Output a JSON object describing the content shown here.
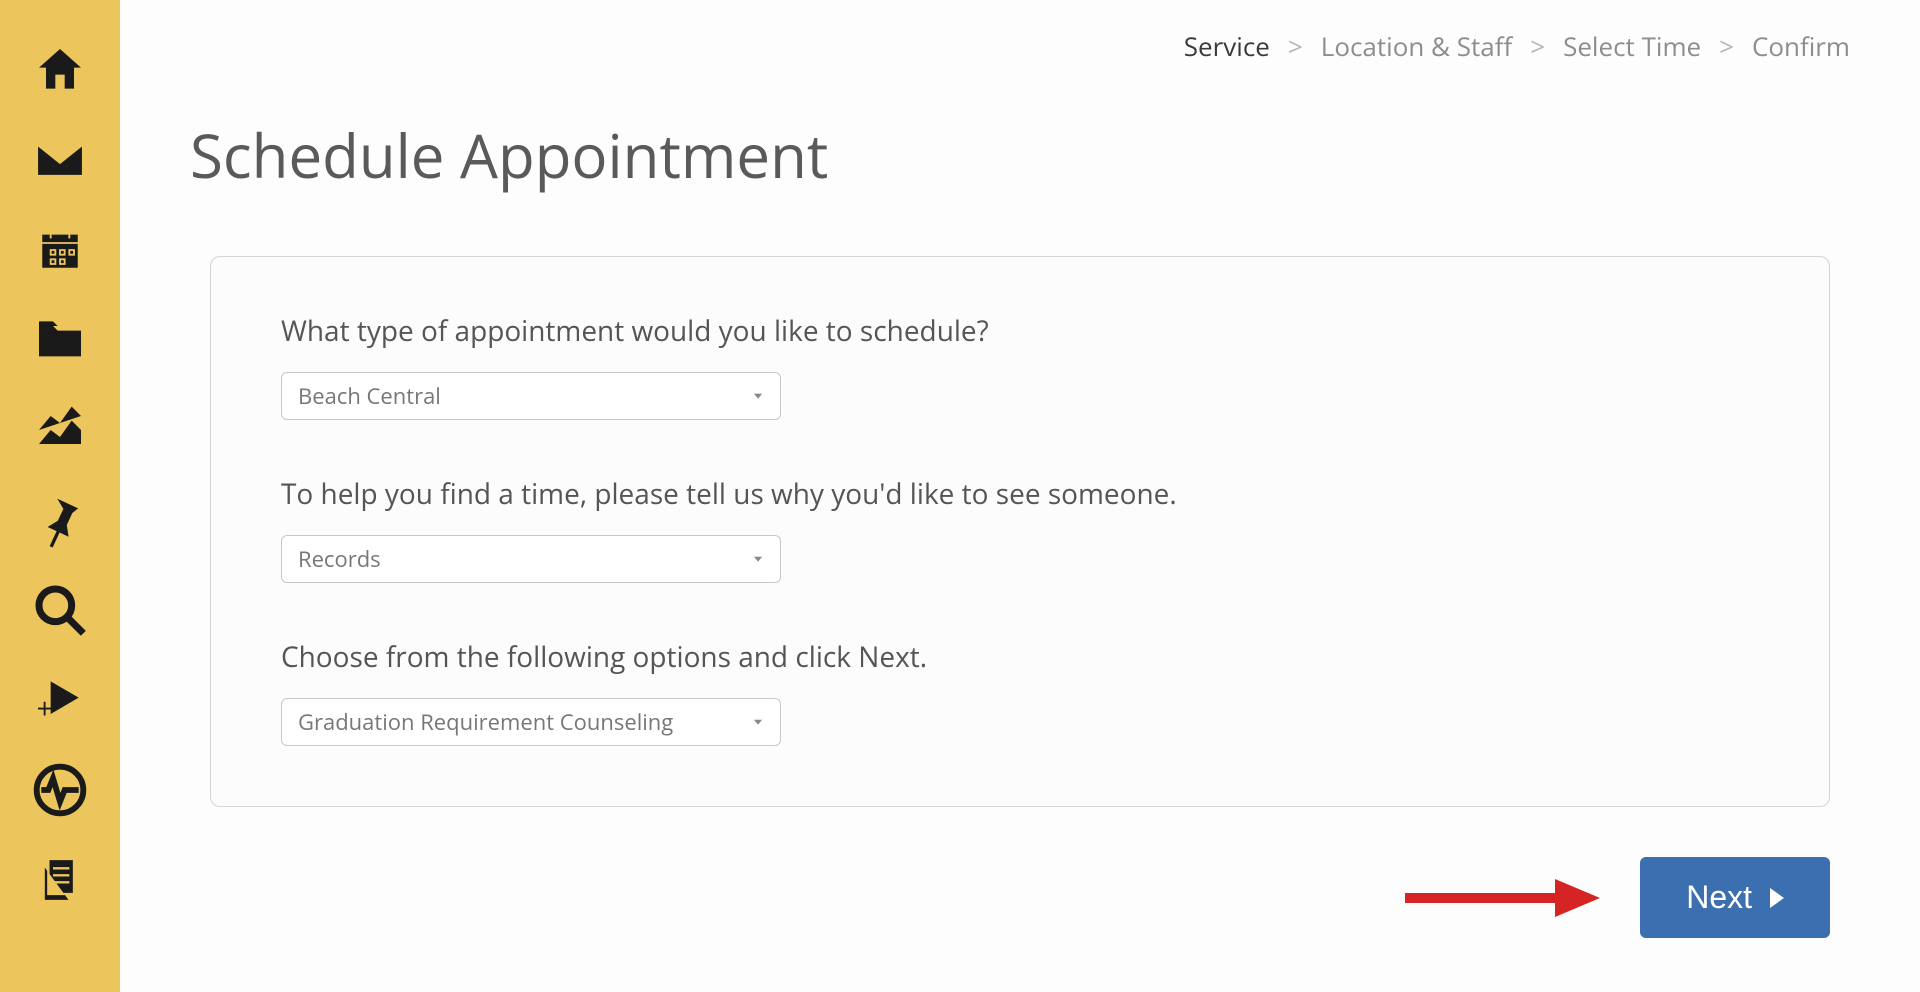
{
  "breadcrumb": {
    "steps": [
      "Service",
      "Location & Staff",
      "Select Time",
      "Confirm"
    ],
    "active_index": 0
  },
  "page_title": "Schedule Appointment",
  "form": {
    "q1_label": "What type of appointment would you like to schedule?",
    "q1_value": "Beach Central",
    "q2_label": "To help you find a time, please tell us why you'd like to see someone.",
    "q2_value": "Records",
    "q3_label": "Choose from the following options and click Next.",
    "q3_value": "Graduation Requirement Counseling"
  },
  "next_button": "Next",
  "sidebar_icons": [
    "home-icon",
    "mail-icon",
    "calendar-icon",
    "folder-icon",
    "chart-icon",
    "pin-icon",
    "search-icon",
    "bookmark-add-icon",
    "pulse-icon",
    "docs-icon"
  ]
}
